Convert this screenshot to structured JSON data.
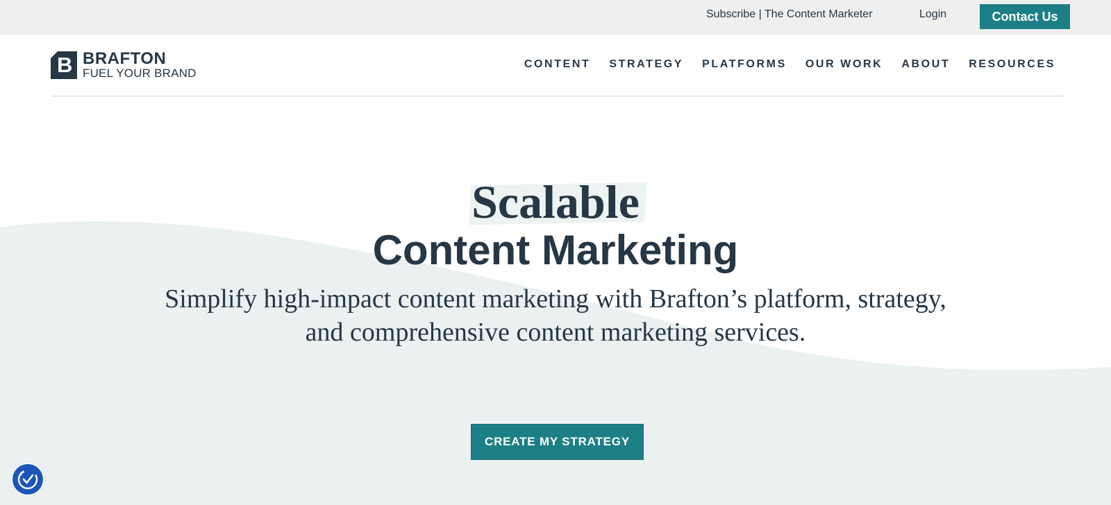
{
  "utility_bar": {
    "subscribe": "Subscribe | The Content Marketer",
    "login": "Login",
    "contact": "Contact Us"
  },
  "brand": {
    "name": "BRAFTON",
    "tagline": "FUEL YOUR BRAND",
    "mark": "B"
  },
  "nav": {
    "items": [
      "CONTENT",
      "STRATEGY",
      "PLATFORMS",
      "OUR WORK",
      "ABOUT",
      "RESOURCES"
    ]
  },
  "hero": {
    "title_top": "Scalable",
    "title_main": "Content Marketing",
    "subtitle_line1": "Simplify high-impact content marketing with Brafton’s platform, strategy,",
    "subtitle_line2": "and comprehensive content marketing services.",
    "cta": "CREATE MY STRATEGY"
  },
  "widget": {
    "icon": "accessibility-check-icon"
  },
  "colors": {
    "primary_dark": "#263746",
    "accent_teal": "#1d7f86",
    "wave_bg": "#ebf1f1",
    "utility_bg": "#efefef",
    "widget_blue": "#1c56b8"
  }
}
